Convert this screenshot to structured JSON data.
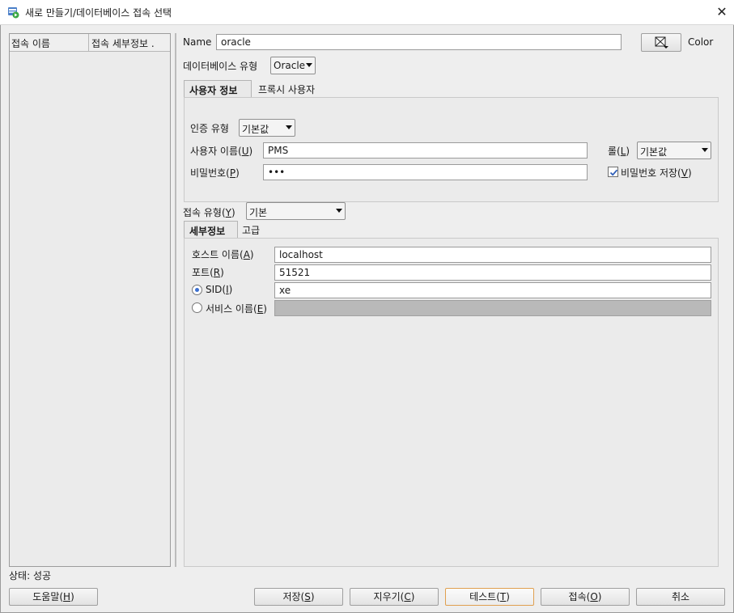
{
  "window": {
    "title": "새로 만들기/데이터베이스 접속 선택",
    "close_glyph": "✕"
  },
  "list": {
    "col1": "접속 이름",
    "col2": "접속 세부정보 ."
  },
  "name": {
    "label": "Name",
    "value": "oracle"
  },
  "color_button": {
    "label": "Color"
  },
  "db_type": {
    "label": "데이터베이스 유형",
    "value": "Oracle"
  },
  "user_tabs": {
    "tab1": "사용자 정보",
    "tab2": "프록시 사용자"
  },
  "auth": {
    "type_label": "인증 유형",
    "type_value": "기본값",
    "user_label_a": "사용자 이름(",
    "user_key": "U",
    "user_label_b": ")",
    "user_value": "PMS",
    "pw_label_a": "비밀번호(",
    "pw_key": "P",
    "pw_label_b": ")",
    "pw_value": "•••",
    "role_label_a": "롤(",
    "role_key": "L",
    "role_label_b": ")",
    "role_value": "기본값",
    "save_pw_label_a": "비밀번호 저장(",
    "save_pw_key": "V",
    "save_pw_label_b": ")",
    "save_pw_checked": true
  },
  "conn_type": {
    "label_a": "접속 유형(",
    "key": "Y",
    "label_b": ")",
    "value": "기본"
  },
  "detail_tabs": {
    "tab1": "세부정보",
    "tab2": "고급"
  },
  "details": {
    "host_label_a": "호스트 이름(",
    "host_key": "A",
    "host_label_b": ")",
    "host_value": "localhost",
    "port_label_a": "포트(",
    "port_key": "R",
    "port_label_b": ")",
    "port_value": "51521",
    "sid_label_a": "SID(",
    "sid_key": "I",
    "sid_label_b": ")",
    "sid_value": "xe",
    "sid_selected": true,
    "svc_label_a": "서비스 이름(",
    "svc_key": "E",
    "svc_label_b": ")",
    "svc_value": ""
  },
  "status": {
    "text": "상태: 성공"
  },
  "buttons": {
    "help_a": "도움말(",
    "help_key": "H",
    "help_b": ")",
    "save_a": "저장(",
    "save_key": "S",
    "save_b": ")",
    "clear_a": "지우기(",
    "clear_key": "C",
    "clear_b": ")",
    "test_a": "테스트(",
    "test_key": "T",
    "test_b": ")",
    "connect_a": "접속(",
    "connect_key": "O",
    "connect_b": ")",
    "cancel": "취소"
  },
  "colors": {
    "accent": "#3b6fd0",
    "focus_border": "#e0a050"
  }
}
